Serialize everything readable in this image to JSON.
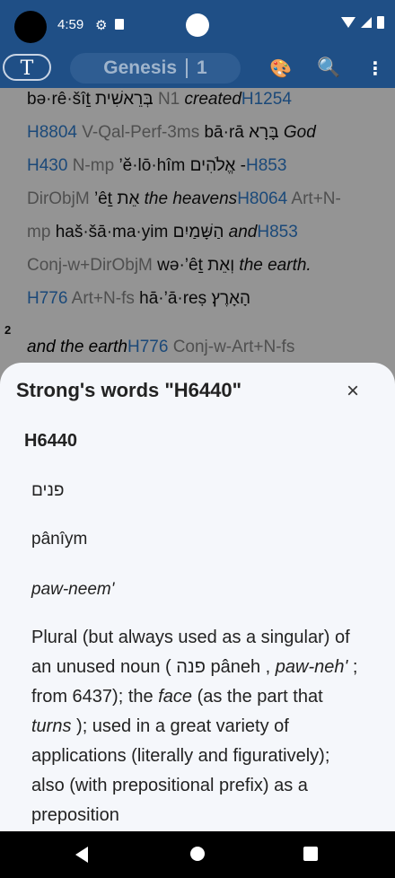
{
  "status": {
    "time": "4:59"
  },
  "toolbar": {
    "font_button": "T",
    "book": "Genesis",
    "chapter": "1"
  },
  "verse1": {
    "r1_translit": "bə·rê·šîṯ",
    "r1_hebrew": "בְּרֵאשִׁית",
    "r1_gram": "N1",
    "r1_eng": "created",
    "r1_strong": "H1254",
    "r2_strong": "H8804",
    "r2_gram": "V-Qal-Perf-3ms",
    "r2_translit": "bā·rā",
    "r2_hebrew": "בָּרָא",
    "r2_eng": "God",
    "r3_strong": "H430",
    "r3_gram": "N-mp",
    "r3_translit": "’ĕ·lō·hîm",
    "r3_hebrew": "אֱלֹהִים",
    "r3_dash": "-",
    "r3_strong2": "H853",
    "r4_gram": "DirObjM",
    "r4_translit": "’êṯ",
    "r4_hebrew": "אֵת",
    "r4_eng": "the heavens",
    "r4_strong": "H8064",
    "r4_gram2": "Art+N-",
    "r5_gram": "mp",
    "r5_translit": "haš·šā·ma·yim",
    "r5_hebrew": "הַשָּׁמַיִם",
    "r5_eng": "and",
    "r5_strong": "H853",
    "r6_gram": "Conj-w+DirObjM",
    "r6_translit": "wə·’êṯ",
    "r6_hebrew": "וְאֵת",
    "r6_eng": "the earth.",
    "r7_strong": "H776",
    "r7_gram": "Art+N-fs",
    "r7_translit": "hā·’ā·reṣ",
    "r7_hebrew": "הָאָרֶץ׃"
  },
  "verse2": {
    "number": "2",
    "eng": "and the earth",
    "strong": "H776",
    "gram": "Conj-w-Art+N-fs"
  },
  "sheet": {
    "title": "Strong's words \"H6440\"",
    "close": "×",
    "entry_id": "H6440",
    "hebrew": "פנים",
    "transliteration": "pânîym",
    "pronunciation": "paw-neem'",
    "def_1": "Plural (but always used as a singular) of an unused noun ( פנה",
    "def_2": "pâneh ,",
    "def_3": "paw-neh'",
    "def_4": "; from 6437); the",
    "def_5": "face",
    "def_6": "(as the part that",
    "def_7": "turns",
    "def_8": "); used in a great variety of applications (literally and figuratively); also (with prepositional prefix) as a preposition"
  }
}
